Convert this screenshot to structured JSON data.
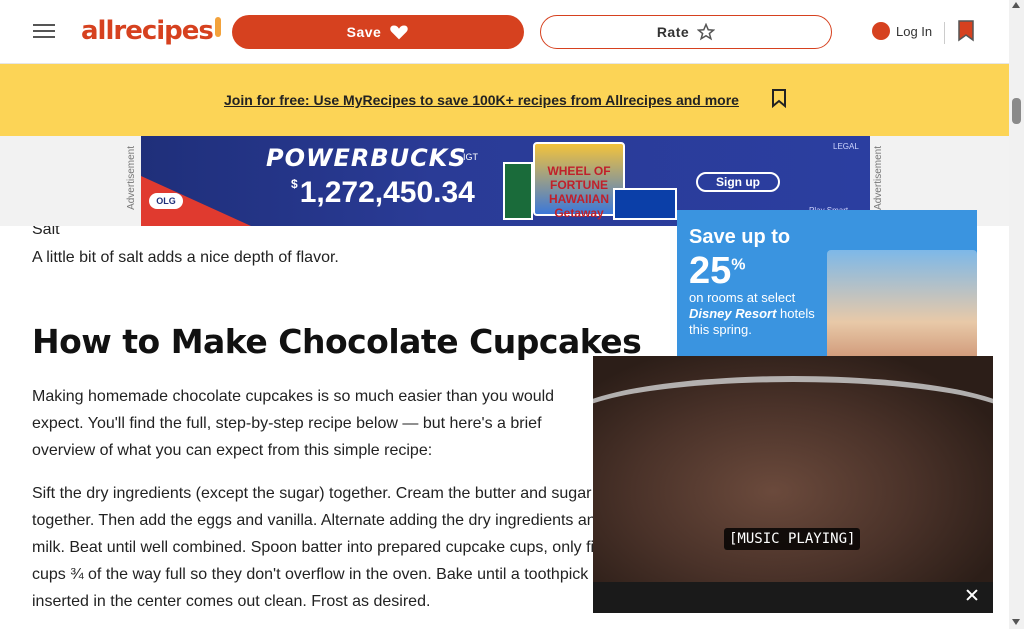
{
  "header": {
    "logo_text": "allrecipes",
    "save_label": "Save",
    "rate_label": "Rate",
    "login_label": "Log In",
    "icons": [
      "menu-icon",
      "heart-icon",
      "star-icon",
      "user-icon",
      "bookmark-icon"
    ],
    "brand_color": "#d6411f"
  },
  "promo": {
    "link_text": "Join for free: Use MyRecipes to save 100K+ recipes from Allrecipes and more",
    "background": "#fcd456"
  },
  "ads": {
    "label": "Advertisement",
    "banner": {
      "title": "POWERBUCKS",
      "brand": "IGT",
      "currency": "$",
      "amount": "1,272,450.34",
      "sponsor": "OLG",
      "game": "WHEEL OF FORTUNE HAWAIIAN Getaway",
      "cta": "Sign up",
      "disclaimer": "LEGAL",
      "footer": "Play Smart"
    },
    "rail": {
      "line1": "Save up to",
      "amount": "25",
      "unit": "%",
      "desc_pre": "on rooms at select",
      "desc_brand": "Disney Resort",
      "desc_post": "hotels this spring."
    }
  },
  "article": {
    "cut_label": "Salt",
    "salt_text": "A little bit of salt adds a nice depth of flavor.",
    "heading": "How to Make Chocolate Cupcakes",
    "para1": "Making homemade chocolate cupcakes is so much easier than you would expect. You'll find the full, step-by-step recipe below — but here's a brief overview of what you can expect from this simple recipe:",
    "para2": "Sift the dry ingredients (except the sugar) together. Cream the butter and sugar together. Then add the eggs and vanilla. Alternate adding the dry ingredients and milk. Beat until well combined. Spoon batter into prepared cupcake cups, only fill the cups ¾ of the way full so they don't overflow in the oven. Bake until a toothpick inserted in the center comes out clean. Frost as desired."
  },
  "video": {
    "caption": "[MUSIC PLAYING]"
  }
}
